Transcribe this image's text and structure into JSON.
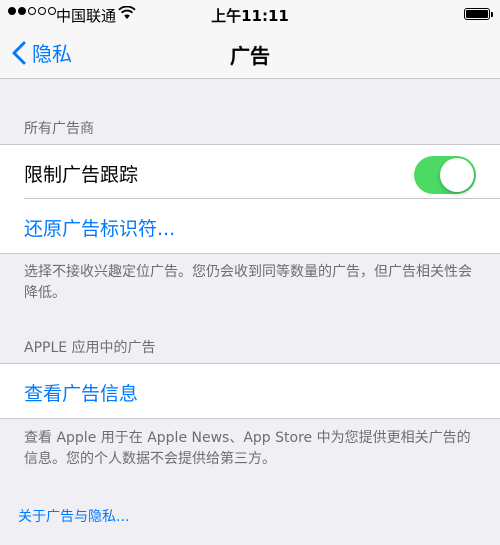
{
  "status_bar": {
    "carrier": "中国联通",
    "time": "上午11:11",
    "signal_bars": 2,
    "battery_level": 1.0
  },
  "nav": {
    "back_label": "隐私",
    "title": "广告"
  },
  "sections": {
    "advertisers_header": "所有广告商",
    "limit_tracking_label": "限制广告跟踪",
    "limit_tracking_on": true,
    "reset_identifier_label": "还原广告标识符...",
    "tracking_footnote": "选择不接收兴趣定位广告。您仍会收到同等数量的广告，但广告相关性会降低。",
    "apple_apps_header": "APPLE 应用中的广告",
    "view_ad_info_label": "查看广告信息",
    "apple_footnote": "查看 Apple 用于在 Apple News、App Store 中为您提供更相关广告的信息。您的个人数据不会提供给第三方。"
  },
  "footer": {
    "about_link": "关于广告与隐私..."
  },
  "colors": {
    "accent": "#007aff",
    "toggle_on": "#4cd964",
    "background": "#efeff4"
  }
}
